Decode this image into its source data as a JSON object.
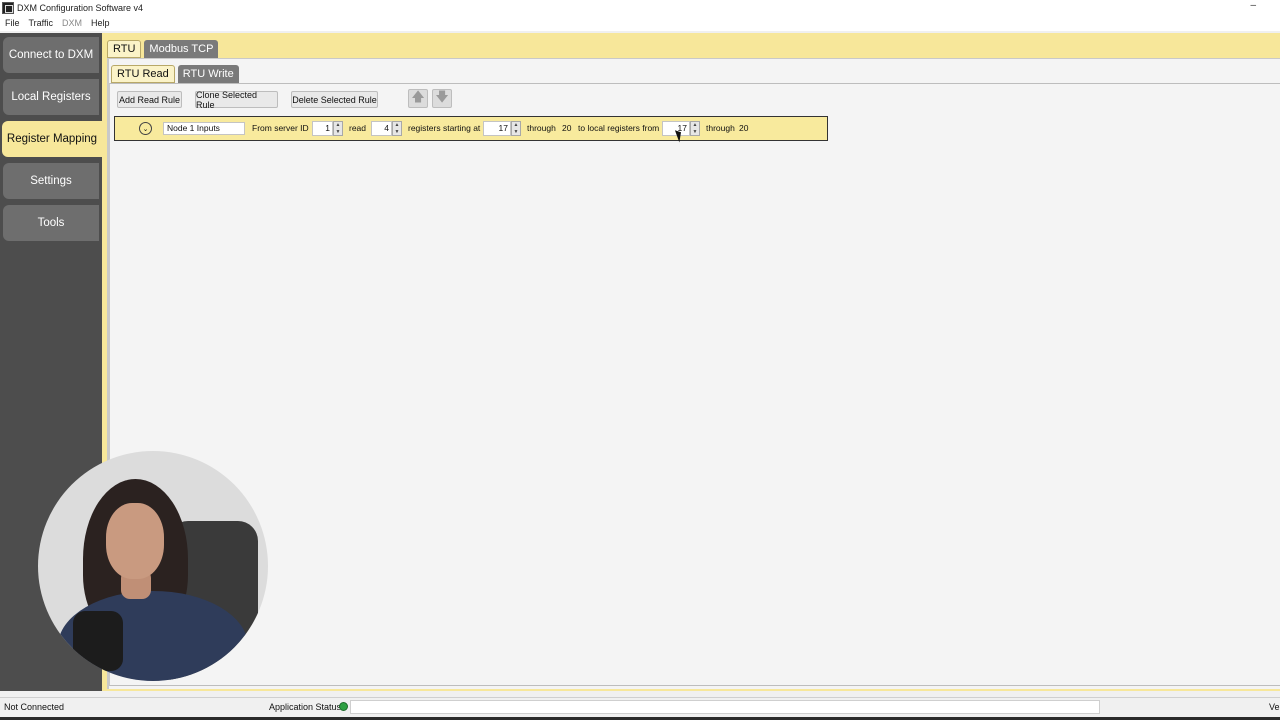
{
  "window": {
    "title": "DXM Configuration Software v4",
    "minimize_glyph": "–"
  },
  "menu": {
    "items": [
      "File",
      "Traffic",
      "DXM",
      "Help"
    ]
  },
  "sidebar": {
    "items": [
      {
        "label": "Connect to DXM"
      },
      {
        "label": "Local Registers"
      },
      {
        "label": "Register Mapping"
      },
      {
        "label": "Settings"
      },
      {
        "label": "Tools"
      }
    ]
  },
  "tabs": {
    "outer": [
      "RTU",
      "Modbus TCP"
    ],
    "inner": [
      "RTU Read",
      "RTU Write"
    ]
  },
  "toolbar": {
    "add_rule": "Add Read Rule",
    "clone_rule": "Clone Selected Rule",
    "delete_rule": "Delete Selected Rule",
    "up_glyph": "🡅",
    "down_glyph": "🡇"
  },
  "rule": {
    "expand_glyph": "⌄",
    "name": "Node 1 Inputs",
    "from_server_label": "From server ID",
    "server_id": "1",
    "read_label": "read",
    "count": "4",
    "starting_label": "registers starting at",
    "start": "17",
    "through_label": "through",
    "end": "20",
    "to_local_label": "to local registers from",
    "local_start": "17",
    "through_label2": "through",
    "local_end": "20"
  },
  "status": {
    "connection": "Not Connected",
    "app_status_label": "Application Status",
    "version_label": "Ve"
  },
  "colors": {
    "accent_yellow": "#f7e79a",
    "sidebar_bg": "#4d4d4d",
    "status_ok": "#2ea043"
  }
}
